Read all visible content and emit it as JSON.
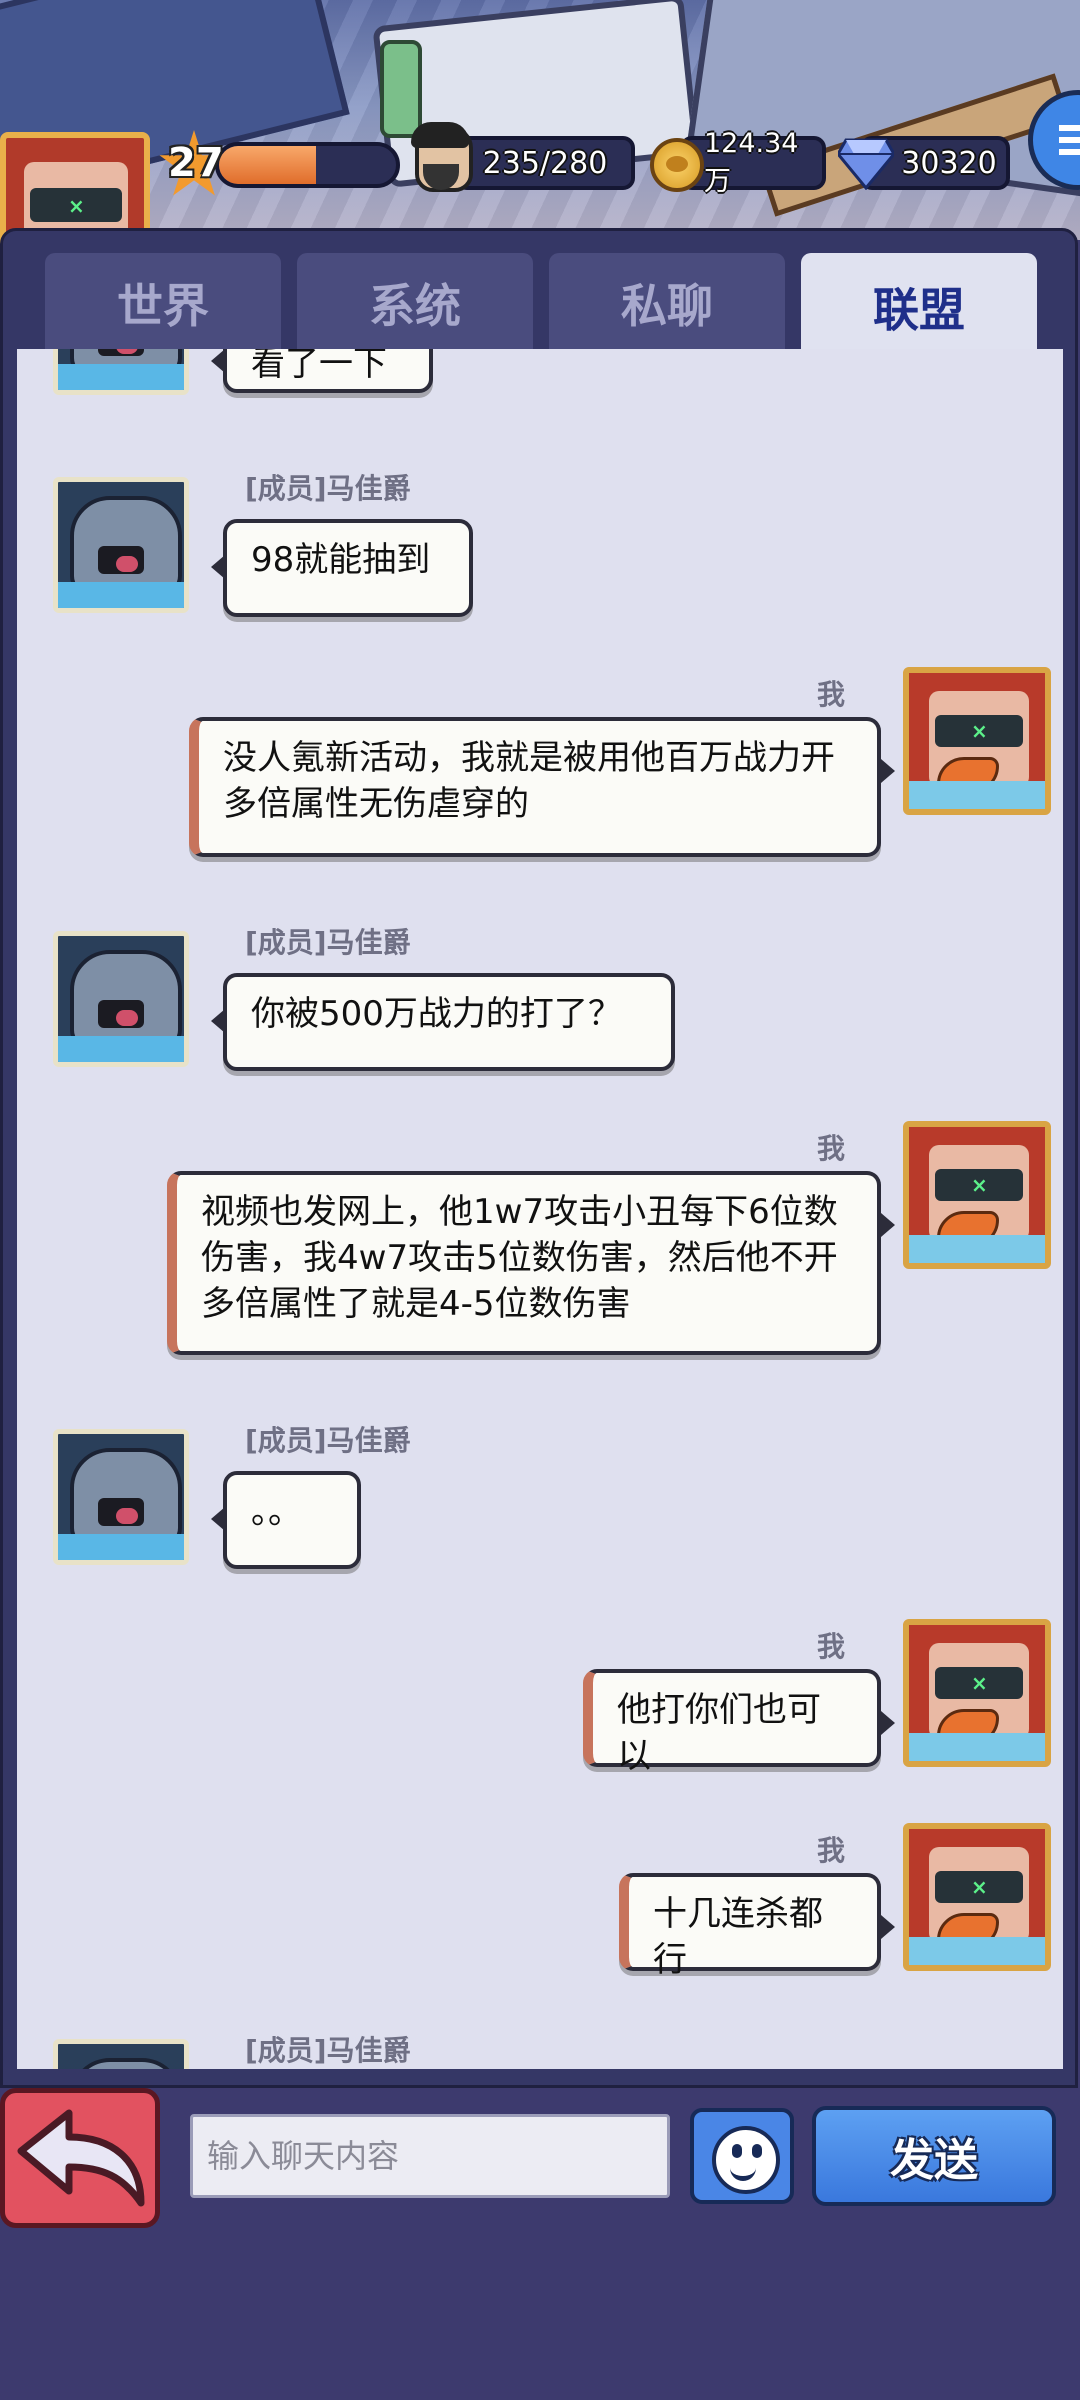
{
  "hud": {
    "level": "27",
    "xp_progress": 0.55,
    "stamina": "235/280",
    "coins": "124.34万",
    "gems": "30320"
  },
  "tabs": [
    {
      "label": "世界",
      "active": false
    },
    {
      "label": "系统",
      "active": false
    },
    {
      "label": "私聊",
      "active": false
    },
    {
      "label": "联盟",
      "active": true
    }
  ],
  "messages": [
    {
      "side": "left",
      "name": "",
      "text": "看了一下"
    },
    {
      "side": "left",
      "name": "[成员]马佳爵",
      "text": "98就能抽到"
    },
    {
      "side": "right",
      "name": "我",
      "text": "没人氪新活动，我就是被用他百万战力开多倍属性无伤虐穿的"
    },
    {
      "side": "left",
      "name": "[成员]马佳爵",
      "text": "你被500万战力的打了？"
    },
    {
      "side": "right",
      "name": "我",
      "text": "视频也发网上，他1w7攻击小丑每下6位数伤害，我4w7攻击5位数伤害，然后他不开多倍属性了就是4-5位数伤害"
    },
    {
      "side": "left",
      "name": "[成员]马佳爵",
      "text": "。。"
    },
    {
      "side": "right",
      "name": "我",
      "text": "他打你们也可以"
    },
    {
      "side": "right",
      "name": "我",
      "text": "十几连杀都行"
    },
    {
      "side": "left",
      "name": "[成员]马佳爵",
      "text": ""
    }
  ],
  "input": {
    "placeholder": "输入聊天内容",
    "send_label": "发送"
  },
  "icons": {
    "back": "back-arrow-icon",
    "emoji": "smiley-icon",
    "coin": "coin-icon",
    "gem": "diamond-icon",
    "menu": "menu-icon"
  }
}
